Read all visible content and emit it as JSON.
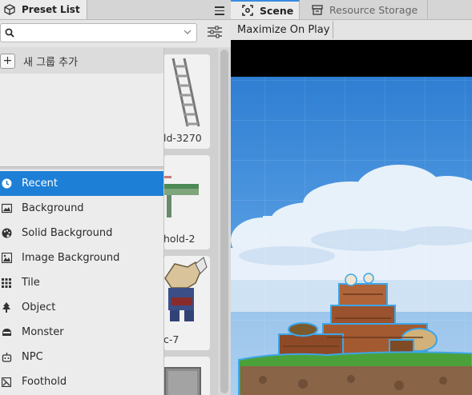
{
  "left_panel": {
    "tab_title": "Preset List",
    "search": {
      "value": "",
      "placeholder": ""
    },
    "new_group_label": "새 그룹 추가",
    "categories": [
      {
        "label": "Recent",
        "icon": "clock-icon",
        "selected": true
      },
      {
        "label": "Background",
        "icon": "image-icon",
        "selected": false
      },
      {
        "label": "Solid Background",
        "icon": "palette-icon",
        "selected": false
      },
      {
        "label": "Image Background",
        "icon": "picture-icon",
        "selected": false
      },
      {
        "label": "Tile",
        "icon": "grid-icon",
        "selected": false
      },
      {
        "label": "Object",
        "icon": "tree-icon",
        "selected": false
      },
      {
        "label": "Monster",
        "icon": "monster-icon",
        "selected": false
      },
      {
        "label": "NPC",
        "icon": "robot-icon",
        "selected": false
      },
      {
        "label": "Foothold",
        "icon": "flag-icon",
        "selected": false
      }
    ],
    "presets": [
      {
        "caption": "ld-3270"
      },
      {
        "caption": "hold-2"
      },
      {
        "caption": "c-7"
      },
      {
        "caption": ""
      }
    ]
  },
  "right_panel": {
    "tabs": [
      {
        "label": "Scene",
        "active": true,
        "icon": "scene-icon"
      },
      {
        "label": "Resource Storage",
        "active": false,
        "icon": "storage-icon"
      }
    ],
    "maximize_label": "Maximize On Play"
  },
  "colors": {
    "selection": "#1d7fd6",
    "active_tab_accent": "#3a8be0"
  }
}
